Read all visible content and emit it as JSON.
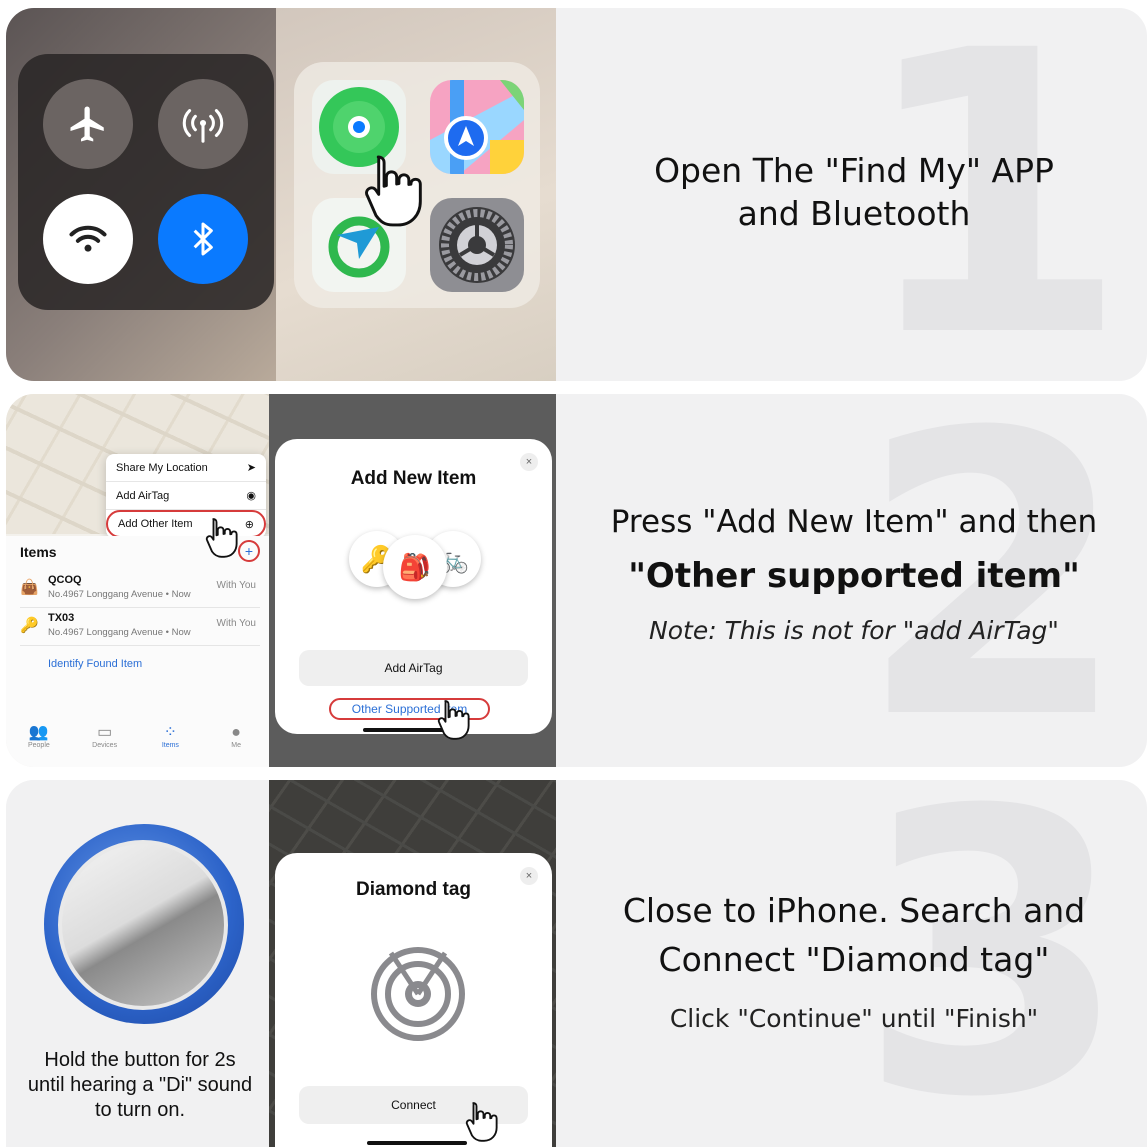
{
  "step1": {
    "number": "1",
    "title_line1": "Open The \"Find My\" APP",
    "title_line2": "and Bluetooth",
    "icons": [
      "airplane-icon",
      "antenna-icon",
      "wifi-icon",
      "bluetooth-icon",
      "find-my-icon",
      "maps-icon",
      "arrow-app-icon",
      "settings-icon",
      "hand-pointer-icon"
    ]
  },
  "step2": {
    "number": "2",
    "title_line1": "Press \"Add New Item\" and then",
    "title_line2": "\"Other supported item\"",
    "note": "Note: This is not for \"add AirTag\"",
    "menu": {
      "share": "Share My Location",
      "airtag": "Add AirTag",
      "other": "Add Other Item"
    },
    "items_header": "Items",
    "items": [
      {
        "name": "QCOQ",
        "sub": "No.4967 Longgang Avenue • Now",
        "status": "With You"
      },
      {
        "name": "TX03",
        "sub": "No.4967 Longgang Avenue • Now",
        "status": "With You"
      }
    ],
    "identify": "Identify Found Item",
    "tabs": [
      "People",
      "Devices",
      "Items",
      "Me"
    ],
    "sheet_title": "Add New Item",
    "add_airtag": "Add AirTag",
    "other_supported": "Other Supported Item",
    "close": "×"
  },
  "step3": {
    "number": "3",
    "title_line1": "Close to iPhone. Search and",
    "title_line2": "Connect \"Diamond tag\"",
    "note": "Click \"Continue\" until \"Finish\"",
    "hold_line1": "Hold the button for 2s",
    "hold_line2": "until hearing a \"Di\" sound",
    "hold_line3": "to turn on.",
    "sheet_title": "Diamond tag",
    "connect": "Connect",
    "close": "×"
  },
  "colors": {
    "accent_blue": "#2b6fd6",
    "bluetooth_blue": "#0a7aff",
    "highlight_red": "#d63b3b",
    "panel_bg": "#f1f1f2"
  }
}
